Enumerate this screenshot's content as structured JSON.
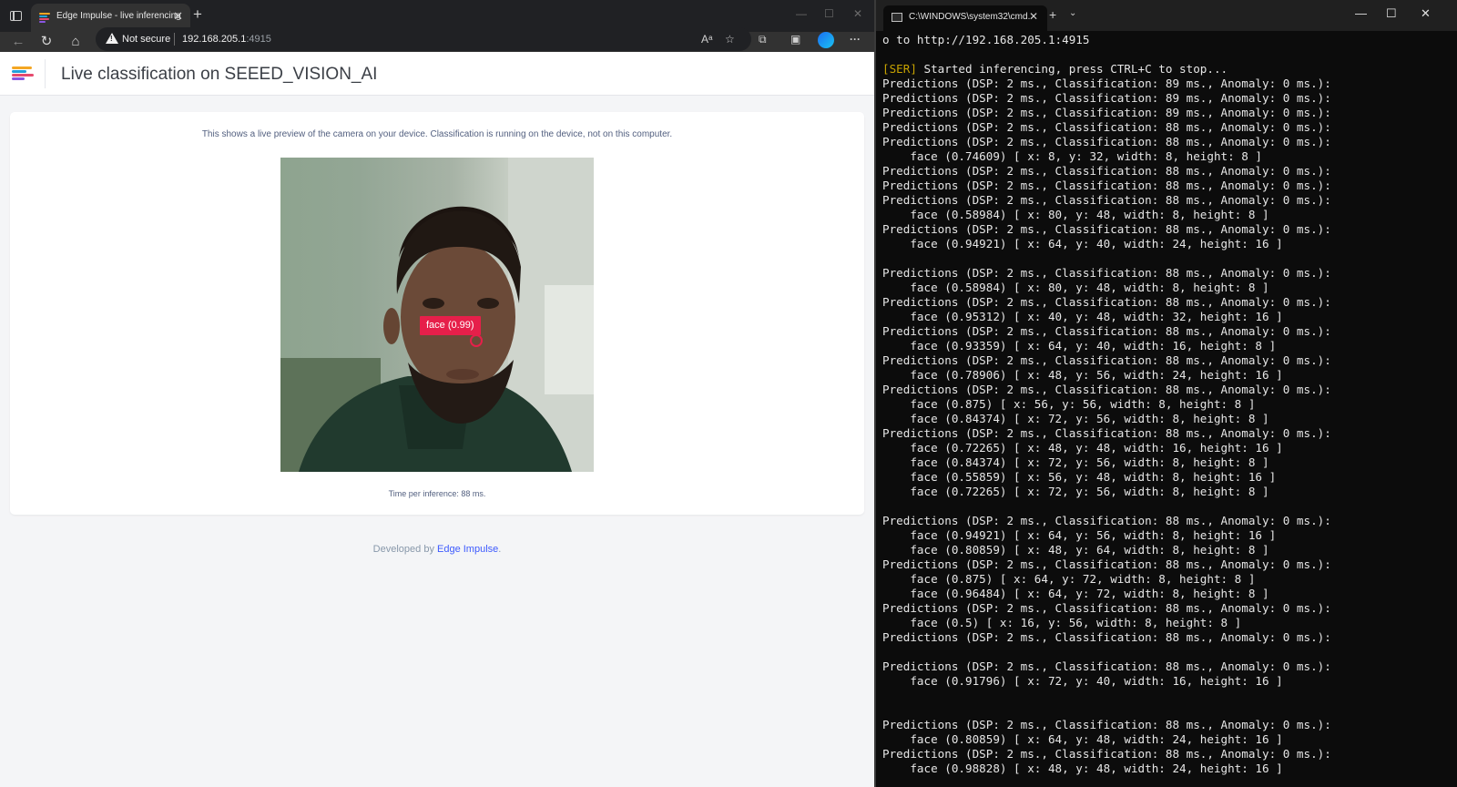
{
  "browser": {
    "tab_title": "Edge Impulse - live inferencing",
    "not_secure": "Not secure",
    "url_host": "192.168.205.1",
    "url_port": ":4915",
    "favicon_colors": [
      "#f4a623",
      "#24a0d9",
      "#e64a6e",
      "#8a56e2"
    ]
  },
  "page": {
    "title": "Live classification on SEEED_VISION_AI",
    "description": "This shows a live preview of the camera on your device. Classification is running on the device, not on this computer.",
    "time_prefix": "Time per inference: ",
    "time_value": "88 ms.",
    "bbox_label": "face (0.99)",
    "footer_prefix": "Developed by ",
    "footer_link": "Edge Impulse",
    "footer_suffix": ".",
    "accent": "#e61f4a"
  },
  "terminal": {
    "tab_title": "C:\\WINDOWS\\system32\\cmd.",
    "ser_tag": "[SER]",
    "ser_text": " Started inferencing, press CTRL+C to stop...",
    "lines": [
      "o to http://192.168.205.1:4915",
      "",
      "__SER__",
      "Predictions (DSP: 2 ms., Classification: 89 ms., Anomaly: 0 ms.):",
      "Predictions (DSP: 2 ms., Classification: 89 ms., Anomaly: 0 ms.):",
      "Predictions (DSP: 2 ms., Classification: 89 ms., Anomaly: 0 ms.):",
      "Predictions (DSP: 2 ms., Classification: 88 ms., Anomaly: 0 ms.):",
      "Predictions (DSP: 2 ms., Classification: 88 ms., Anomaly: 0 ms.):",
      "    face (0.74609) [ x: 8, y: 32, width: 8, height: 8 ]",
      "Predictions (DSP: 2 ms., Classification: 88 ms., Anomaly: 0 ms.):",
      "Predictions (DSP: 2 ms., Classification: 88 ms., Anomaly: 0 ms.):",
      "Predictions (DSP: 2 ms., Classification: 88 ms., Anomaly: 0 ms.):",
      "    face (0.58984) [ x: 80, y: 48, width: 8, height: 8 ]",
      "Predictions (DSP: 2 ms., Classification: 88 ms., Anomaly: 0 ms.):",
      "    face (0.94921) [ x: 64, y: 40, width: 24, height: 16 ]",
      "",
      "Predictions (DSP: 2 ms., Classification: 88 ms., Anomaly: 0 ms.):",
      "    face (0.58984) [ x: 80, y: 48, width: 8, height: 8 ]",
      "Predictions (DSP: 2 ms., Classification: 88 ms., Anomaly: 0 ms.):",
      "    face (0.95312) [ x: 40, y: 48, width: 32, height: 16 ]",
      "Predictions (DSP: 2 ms., Classification: 88 ms., Anomaly: 0 ms.):",
      "    face (0.93359) [ x: 64, y: 40, width: 16, height: 8 ]",
      "Predictions (DSP: 2 ms., Classification: 88 ms., Anomaly: 0 ms.):",
      "    face (0.78906) [ x: 48, y: 56, width: 24, height: 16 ]",
      "Predictions (DSP: 2 ms., Classification: 88 ms., Anomaly: 0 ms.):",
      "    face (0.875) [ x: 56, y: 56, width: 8, height: 8 ]",
      "    face (0.84374) [ x: 72, y: 56, width: 8, height: 8 ]",
      "Predictions (DSP: 2 ms., Classification: 88 ms., Anomaly: 0 ms.):",
      "    face (0.72265) [ x: 48, y: 48, width: 16, height: 16 ]",
      "    face (0.84374) [ x: 72, y: 56, width: 8, height: 8 ]",
      "    face (0.55859) [ x: 56, y: 48, width: 8, height: 16 ]",
      "    face (0.72265) [ x: 72, y: 56, width: 8, height: 8 ]",
      "",
      "Predictions (DSP: 2 ms., Classification: 88 ms., Anomaly: 0 ms.):",
      "    face (0.94921) [ x: 64, y: 56, width: 8, height: 16 ]",
      "    face (0.80859) [ x: 48, y: 64, width: 8, height: 8 ]",
      "Predictions (DSP: 2 ms., Classification: 88 ms., Anomaly: 0 ms.):",
      "    face (0.875) [ x: 64, y: 72, width: 8, height: 8 ]",
      "    face (0.96484) [ x: 64, y: 72, width: 8, height: 8 ]",
      "Predictions (DSP: 2 ms., Classification: 88 ms., Anomaly: 0 ms.):",
      "    face (0.5) [ x: 16, y: 56, width: 8, height: 8 ]",
      "Predictions (DSP: 2 ms., Classification: 88 ms., Anomaly: 0 ms.):",
      "",
      "Predictions (DSP: 2 ms., Classification: 88 ms., Anomaly: 0 ms.):",
      "    face (0.91796) [ x: 72, y: 40, width: 16, height: 16 ]",
      "",
      "",
      "Predictions (DSP: 2 ms., Classification: 88 ms., Anomaly: 0 ms.):",
      "    face (0.80859) [ x: 64, y: 48, width: 24, height: 16 ]",
      "Predictions (DSP: 2 ms., Classification: 88 ms., Anomaly: 0 ms.):",
      "    face (0.98828) [ x: 48, y: 48, width: 24, height: 16 ]"
    ]
  }
}
